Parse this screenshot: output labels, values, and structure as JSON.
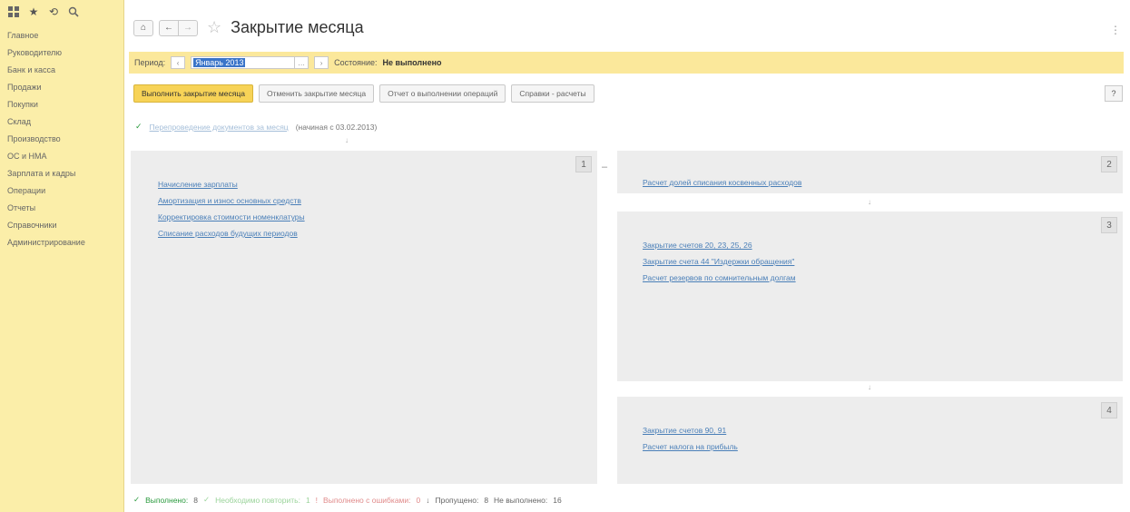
{
  "sidebar": {
    "icons": [
      "grid-icon",
      "star-icon",
      "history-icon",
      "search-icon"
    ],
    "items": [
      "Главное",
      "Руководителю",
      "Банк и касса",
      "Продажи",
      "Покупки",
      "Склад",
      "Производство",
      "ОС и НМА",
      "Зарплата и кадры",
      "Операции",
      "Отчеты",
      "Справочники",
      "Администрирование"
    ]
  },
  "header": {
    "title": "Закрытие месяца"
  },
  "period_bar": {
    "label": "Период:",
    "value": "Январь 2013",
    "status_label": "Состояние:",
    "status_value": "Не выполнено"
  },
  "actions": {
    "run": "Выполнить закрытие месяца",
    "cancel": "Отменить закрытие месяца",
    "report": "Отчет о выполнении операций",
    "help_calc": "Справки - расчеты",
    "help": "?"
  },
  "repost": {
    "link": "Перепроведение документов за месяц",
    "note": "(начиная с 03.02.2013)"
  },
  "panels": [
    {
      "number": "1",
      "links": [
        "Начисление зарплаты",
        "Амортизация и износ основных средств",
        "Корректировка стоимости номенклатуры",
        "Списание расходов будущих периодов"
      ]
    },
    {
      "number": "2",
      "links": [
        "Расчет долей списания косвенных расходов"
      ]
    },
    {
      "number": "3",
      "links": [
        "Закрытие счетов 20, 23, 25, 26",
        "Закрытие счета 44 \"Издержки обращения\"",
        "Расчет резервов по сомнительным долгам"
      ]
    },
    {
      "number": "4",
      "links": [
        "Закрытие счетов 90, 91",
        "Расчет налога на прибыль"
      ]
    }
  ],
  "footer": {
    "done_label": "Выполнено:",
    "done_count": "8",
    "need_label": "Необходимо повторить:",
    "need_count": "1",
    "error_label": "Выполнено с ошибками:",
    "error_count": "0",
    "skip_label": "Пропущено:",
    "skip_count": "8",
    "notdone_label": "Не выполнено:",
    "notdone_count": "16"
  },
  "colors": {
    "sidebar_bg": "#fbeea9",
    "period_bar_bg": "#fbe89b",
    "primary_button": "#f7d357",
    "panel_bg": "#ededed",
    "link": "#4a7fb8",
    "success": "#2a9a3e"
  }
}
